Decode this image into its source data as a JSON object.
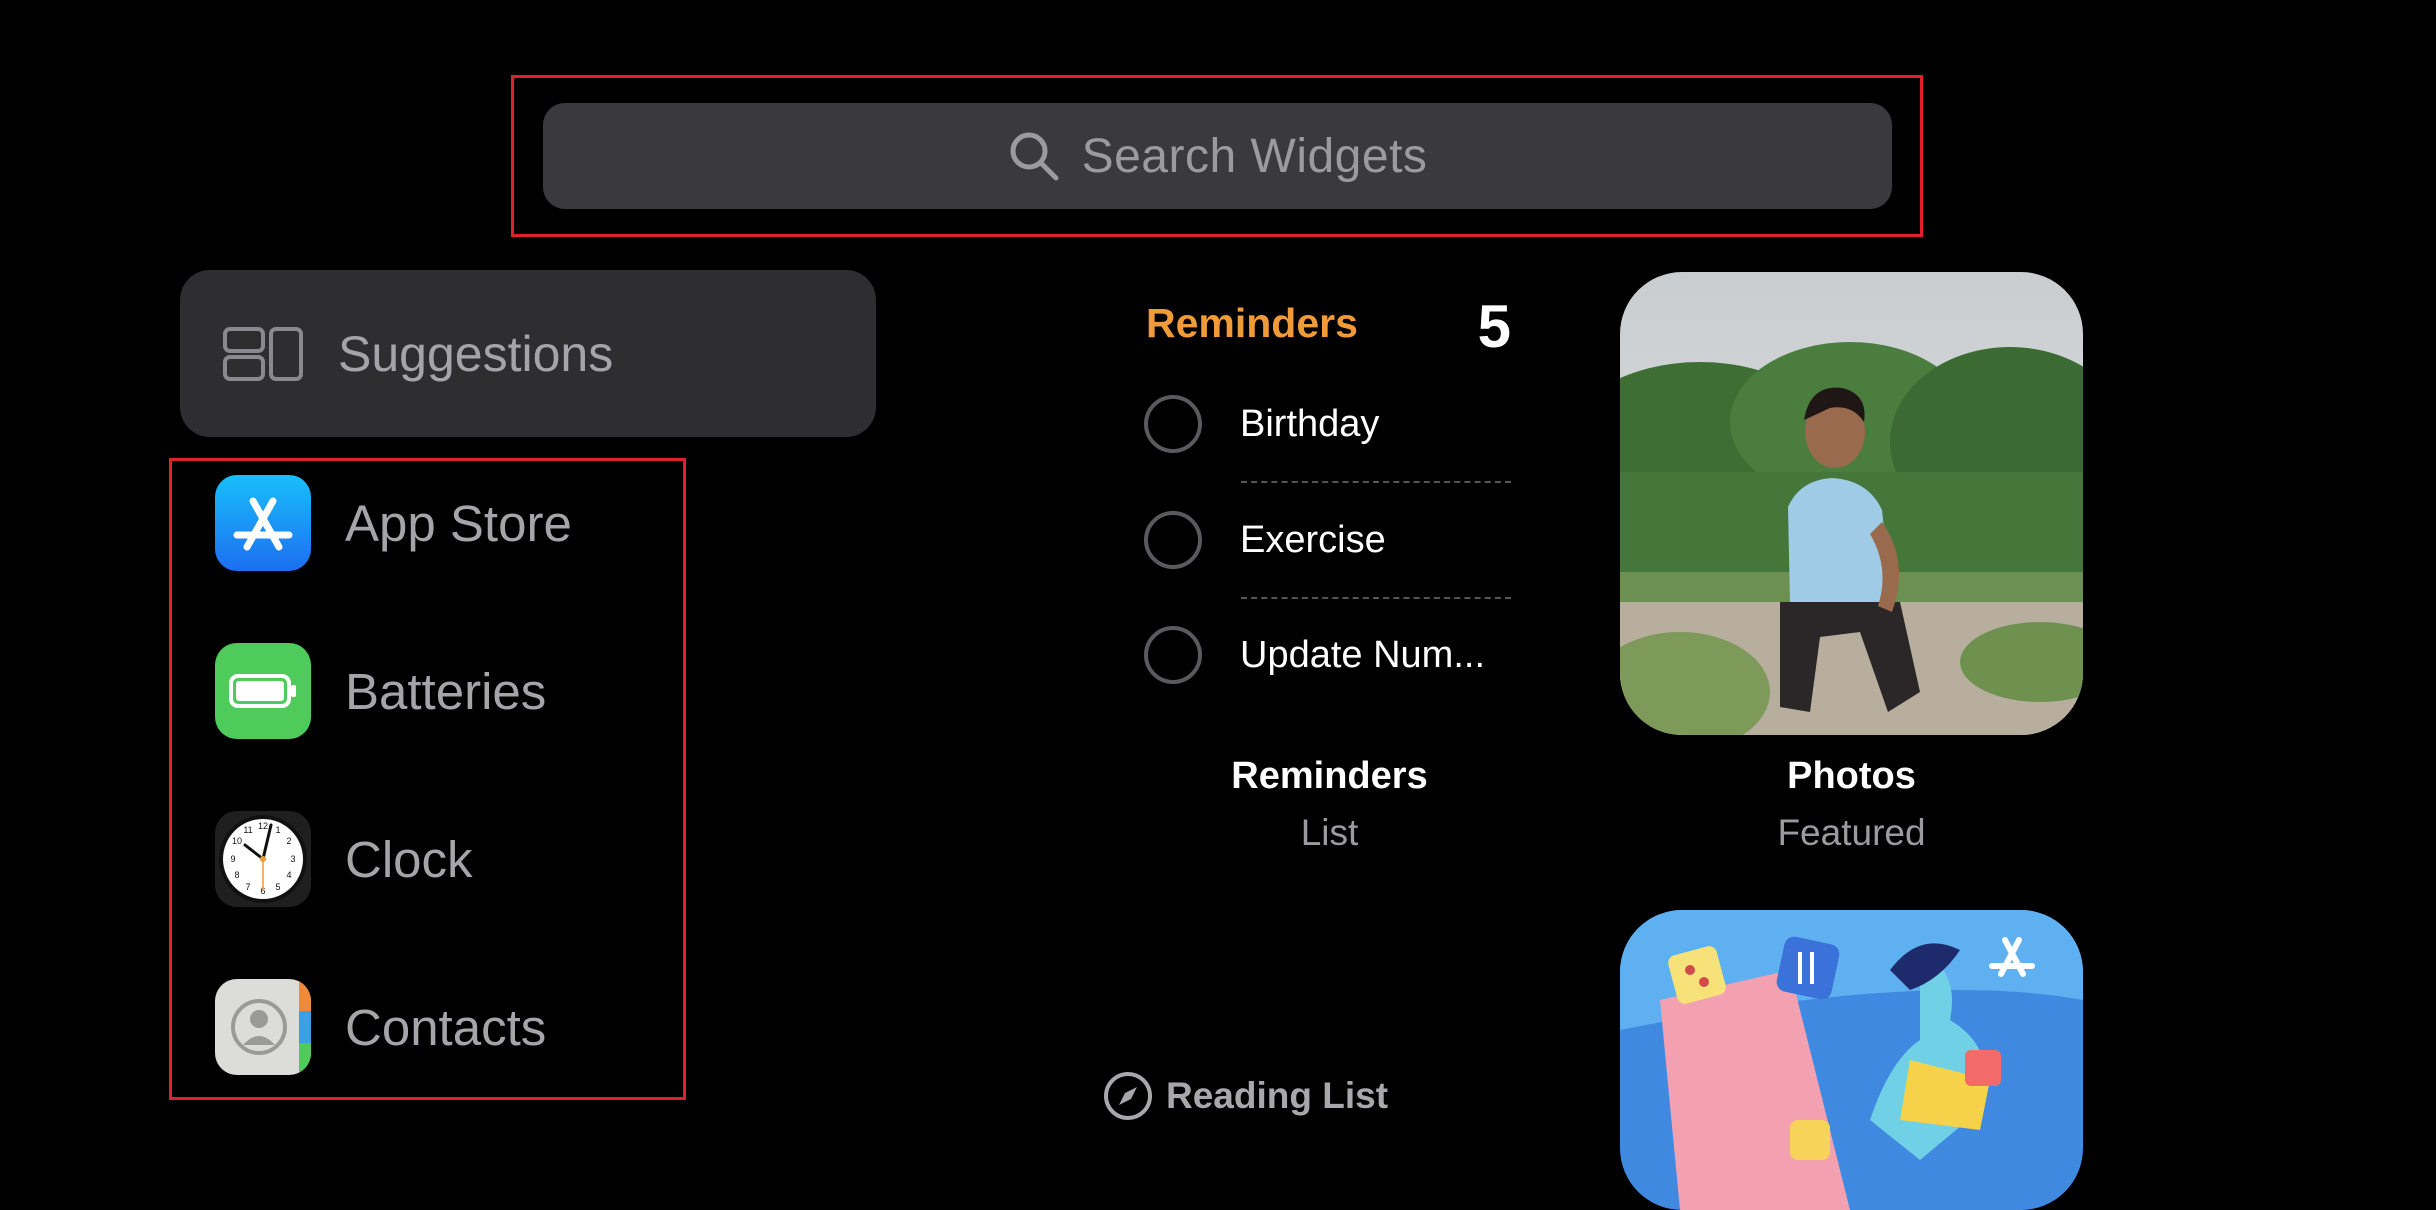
{
  "search": {
    "placeholder": "Search Widgets",
    "icon": "magnifying-glass"
  },
  "sidebar": {
    "suggestions_label": "Suggestions",
    "apps": [
      {
        "label": "App Store",
        "icon": "app-store"
      },
      {
        "label": "Batteries",
        "icon": "battery"
      },
      {
        "label": "Clock",
        "icon": "clock"
      },
      {
        "label": "Contacts",
        "icon": "contacts"
      }
    ]
  },
  "widgets": {
    "reminders": {
      "title": "Reminders",
      "count": "5",
      "items": [
        "Birthday",
        "Exercise",
        "Update Num..."
      ],
      "caption_title": "Reminders",
      "caption_sub": "List"
    },
    "photos": {
      "caption_title": "Photos",
      "caption_sub": "Featured"
    },
    "reading_list": {
      "label": "Reading List"
    }
  },
  "colors": {
    "highlight": "#e0202a",
    "reminders_accent": "#f19a38",
    "battery_green": "#4fcb5b",
    "app_store_blue": "#1d7cf2"
  }
}
